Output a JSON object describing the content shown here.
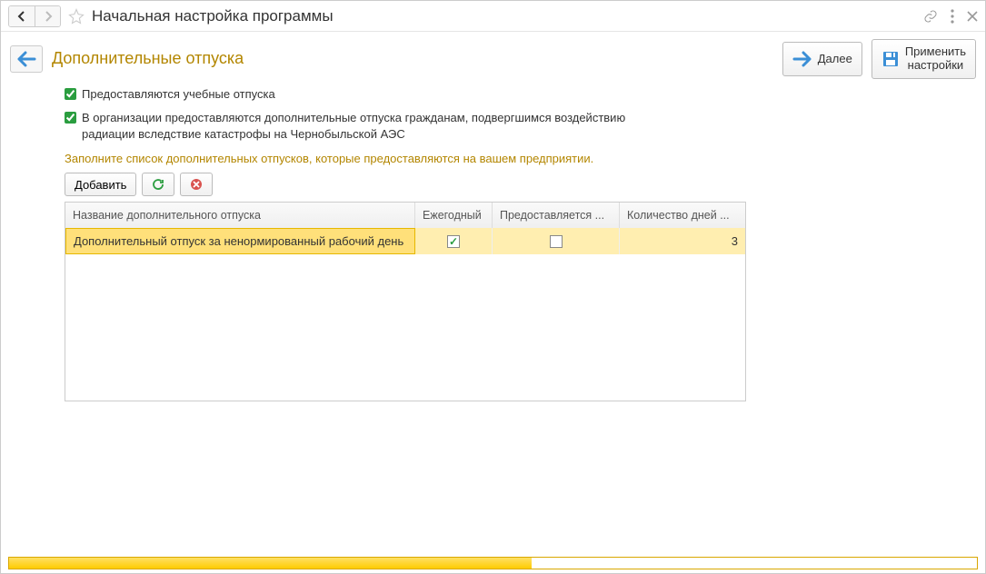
{
  "window": {
    "title": "Начальная настройка программы"
  },
  "section": {
    "title": "Дополнительные отпуска"
  },
  "actions": {
    "next": "Далее",
    "apply_line1": "Применить",
    "apply_line2": "настройки"
  },
  "checks": {
    "edu": {
      "checked": true,
      "label": "Предоставляются учебные отпуска"
    },
    "rad": {
      "checked": true,
      "label": "В организации предоставляются дополнительные отпуска гражданам, подвергшимся воздействию радиации вследствие катастрофы на Чернобыльской АЭС"
    }
  },
  "hint": "Заполните список дополнительных отпусков, которые предоставляются на вашем предприятии.",
  "table_toolbar": {
    "add": "Добавить"
  },
  "table": {
    "headers": [
      "Название дополнительного отпуска",
      "Ежегодный",
      "Предоставляется ...",
      "Количество дней ..."
    ],
    "rows": [
      {
        "name": "Дополнительный отпуск за ненормированный рабочий день",
        "annual": true,
        "provided": false,
        "days": "3"
      }
    ]
  },
  "progress": {
    "percent": 54
  }
}
